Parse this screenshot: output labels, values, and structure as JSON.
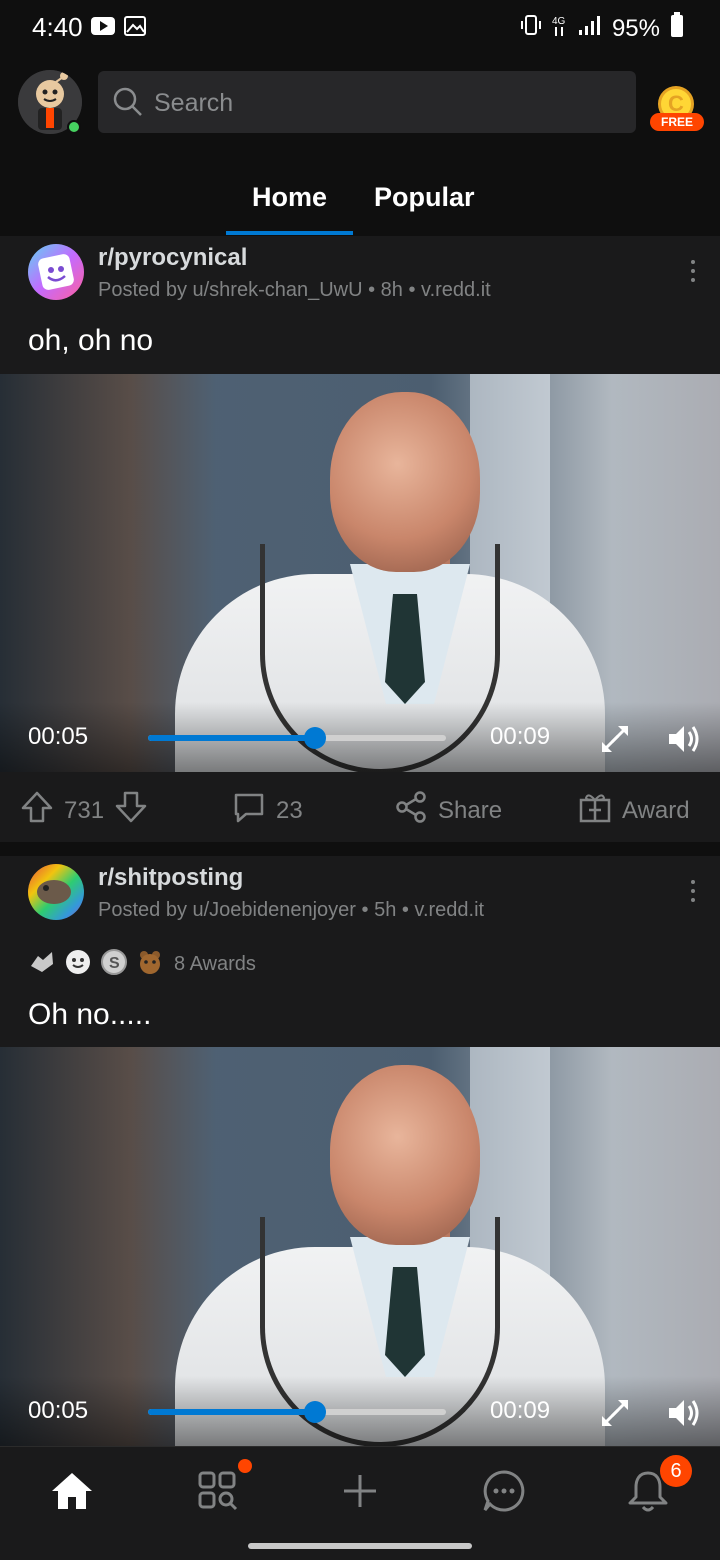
{
  "status_bar": {
    "time": "4:40",
    "battery": "95%"
  },
  "header": {
    "search_placeholder": "Search",
    "coin_letter": "C",
    "free_label": "FREE"
  },
  "tabs": [
    {
      "label": "Home",
      "active": true
    },
    {
      "label": "Popular",
      "active": false
    }
  ],
  "posts": [
    {
      "subreddit": "r/pyrocynical",
      "meta": "Posted by u/shrek-chan_UwU • 8h • v.redd.it",
      "title": "oh, oh no",
      "video": {
        "current": "00:05",
        "duration": "00:09",
        "progress": 0.56
      },
      "actions": {
        "score": "731",
        "comments": "23",
        "share": "Share",
        "award": "Award"
      }
    },
    {
      "subreddit": "r/shitposting",
      "meta": "Posted by u/Joebidenenjoyer • 5h • v.redd.it",
      "awards_count": "8 Awards",
      "title": "Oh no.....",
      "video": {
        "current": "00:05",
        "duration": "00:09",
        "progress": 0.56
      }
    }
  ],
  "bottom_nav": {
    "inbox_badge": "6"
  },
  "colors": {
    "accent": "#0079d3",
    "orangered": "#ff4500",
    "background": "#0f0f0f",
    "card": "#1a1a1b"
  }
}
